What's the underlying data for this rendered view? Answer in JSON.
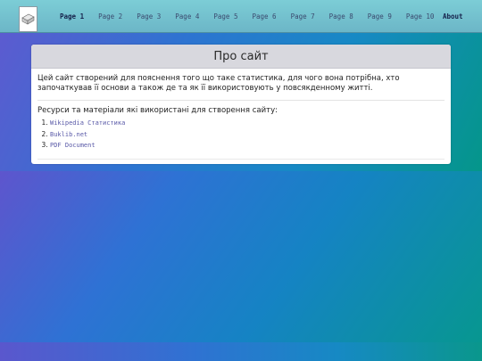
{
  "nav": {
    "logo_icon": "book-icon",
    "pages": [
      "Page 1",
      "Page 2",
      "Page 3",
      "Page 4",
      "Page 5",
      "Page 6",
      "Page 7",
      "Page 8",
      "Page 9",
      "Page 10"
    ],
    "about": "About",
    "active": "Page 1"
  },
  "card": {
    "title": "Про сайт",
    "description": "Цей сайт створений для пояснення того що таке статистика, для чого вона потрібна, хто започаткував її основи а також де та як її використовують у повсякденному житті.",
    "resources_title": "Ресурси та матеріали які використані для створення сайту:",
    "resources": [
      "Wikipedia Статистика",
      "Buklib.net",
      "PDF Document"
    ]
  },
  "colors": {
    "navbar": "#7ccdd6",
    "accent_purple": "#5c5bd0",
    "accent_teal": "#04968a",
    "link": "#5a5aa8"
  }
}
